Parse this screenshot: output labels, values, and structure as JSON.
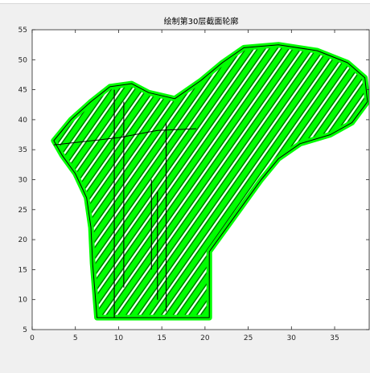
{
  "window": {
    "background": "#f0f0f0"
  },
  "chart_data": {
    "type": "line",
    "title": "绘制第30层截面轮廓",
    "xlabel": "",
    "ylabel": "",
    "xlim": [
      0,
      39
    ],
    "ylim": [
      5,
      55
    ],
    "xticks": [
      "0",
      "5",
      "10",
      "15",
      "20",
      "25",
      "30",
      "35"
    ],
    "yticks": [
      "5",
      "10",
      "15",
      "20",
      "25",
      "30",
      "35",
      "40",
      "45",
      "50",
      "55"
    ],
    "grid": false,
    "colors": {
      "fill": "#00ff00",
      "edge": "#000000",
      "axes_bg": "#ffffff"
    },
    "outline": [
      [
        7.5,
        7.0
      ],
      [
        20.5,
        7.0
      ],
      [
        20.5,
        18.0
      ],
      [
        22.5,
        22.0
      ],
      [
        24.5,
        26.0
      ],
      [
        26.5,
        30.0
      ],
      [
        28.5,
        33.5
      ],
      [
        31.0,
        36.0
      ],
      [
        34.5,
        37.5
      ],
      [
        37.0,
        39.5
      ],
      [
        38.8,
        43.0
      ],
      [
        38.5,
        47.0
      ],
      [
        36.5,
        49.5
      ],
      [
        33.0,
        51.5
      ],
      [
        28.5,
        52.5
      ],
      [
        24.5,
        52.0
      ],
      [
        22.0,
        49.5
      ],
      [
        19.5,
        46.5
      ],
      [
        16.5,
        43.5
      ],
      [
        13.5,
        44.5
      ],
      [
        11.5,
        46.0
      ],
      [
        9.0,
        45.5
      ],
      [
        6.8,
        43.0
      ],
      [
        4.5,
        40.0
      ],
      [
        2.5,
        36.5
      ],
      [
        3.5,
        34.0
      ],
      [
        5.0,
        31.0
      ],
      [
        6.3,
        27.0
      ],
      [
        6.8,
        22.0
      ],
      [
        7.0,
        16.0
      ],
      [
        7.5,
        7.0
      ]
    ],
    "section_line": [
      [
        2.5,
        35.8
      ],
      [
        10.0,
        37.0
      ],
      [
        14.5,
        38.2
      ],
      [
        19.0,
        38.5
      ]
    ],
    "vertical_lines": [
      {
        "x": 9.5,
        "y": [
          7.0,
          45.0
        ]
      },
      {
        "x": 10.6,
        "y": [
          12.0,
          43.0
        ]
      },
      {
        "x": 15.5,
        "y": [
          8.0,
          39.5
        ]
      },
      {
        "x": 13.8,
        "y": [
          15.0,
          30.0
        ]
      },
      {
        "x": 14.5,
        "y": [
          10.0,
          28.0
        ]
      }
    ]
  }
}
